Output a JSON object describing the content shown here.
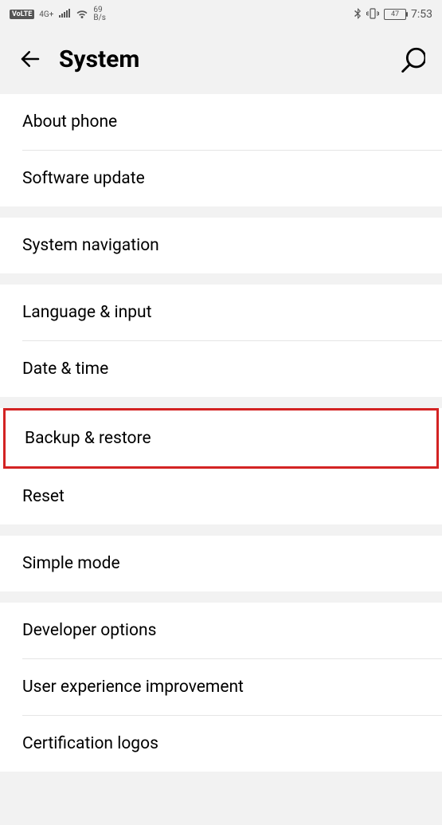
{
  "status_bar": {
    "volte": "VoLTE",
    "network": "4G+",
    "data_rate_top": "69",
    "data_rate_bottom": "B/s",
    "battery_percent": "47",
    "time": "7:53"
  },
  "header": {
    "title": "System"
  },
  "sections": [
    {
      "items": [
        {
          "label": "About phone"
        },
        {
          "label": "Software update"
        }
      ]
    },
    {
      "items": [
        {
          "label": "System navigation"
        }
      ]
    },
    {
      "items": [
        {
          "label": "Language & input"
        },
        {
          "label": "Date & time"
        }
      ]
    },
    {
      "items": [
        {
          "label": "Backup & restore",
          "highlighted": true
        },
        {
          "label": "Reset"
        }
      ]
    },
    {
      "items": [
        {
          "label": "Simple mode"
        }
      ]
    },
    {
      "items": [
        {
          "label": "Developer options"
        },
        {
          "label": "User experience improvement"
        },
        {
          "label": "Certification logos"
        }
      ]
    }
  ]
}
